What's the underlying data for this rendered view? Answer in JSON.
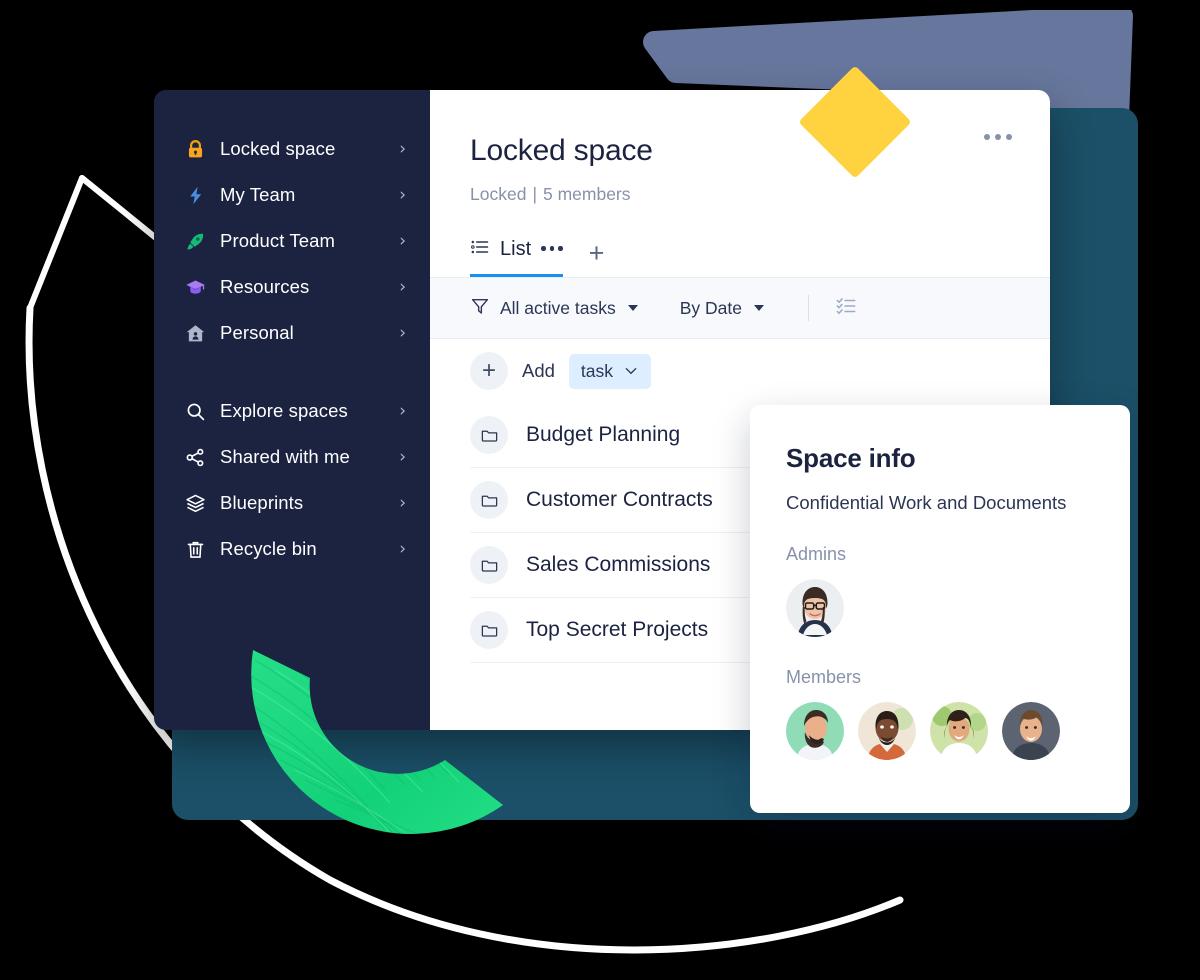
{
  "theme": {
    "sidebar_bg": "#1b2341",
    "teal_card": "#1b5068",
    "accent_blue": "#1b8ff0",
    "yellow_diamond": "#ffd23f",
    "blue_polygon": "#66769c",
    "green_arc": "#20d87f",
    "white_arc": "#ffffff",
    "pill_bg": "#dceeff"
  },
  "sidebar": {
    "spaces": [
      {
        "label": "Locked space",
        "icon": "lock-icon",
        "chevron": "›"
      },
      {
        "label": "My Team",
        "icon": "lightning-icon",
        "chevron": "›"
      },
      {
        "label": "Product Team",
        "icon": "rocket-icon",
        "chevron": "›"
      },
      {
        "label": "Resources",
        "icon": "graduation-icon",
        "chevron": "›"
      },
      {
        "label": "Personal",
        "icon": "home-icon",
        "chevron": "›"
      }
    ],
    "tools": [
      {
        "label": "Explore spaces",
        "icon": "search-icon",
        "chevron": "›"
      },
      {
        "label": "Shared with me",
        "icon": "share-icon",
        "chevron": "›"
      },
      {
        "label": "Blueprints",
        "icon": "layers-icon",
        "chevron": "›"
      },
      {
        "label": "Recycle bin",
        "icon": "trash-icon",
        "chevron": "›"
      }
    ]
  },
  "main": {
    "title": "Locked space",
    "status": "Locked",
    "separator": "|",
    "members_count": "5 members",
    "kebab": "more-options",
    "tabs": [
      {
        "label": "List",
        "icon": "list-view-icon",
        "active": true
      }
    ],
    "add_tab_label": "+",
    "filters": {
      "filter_icon": "funnel-icon",
      "status_filter": "All active tasks",
      "sort_filter": "By Date",
      "checklist_icon": "checklist-icon"
    },
    "add_row": {
      "plus": "+",
      "label": "Add",
      "type": "task"
    },
    "tasks": [
      {
        "name": "Budget Planning",
        "icon": "folder-icon"
      },
      {
        "name": "Customer Contracts",
        "icon": "folder-icon"
      },
      {
        "name": "Sales Commissions",
        "icon": "folder-icon"
      },
      {
        "name": "Top Secret Projects",
        "icon": "folder-icon"
      }
    ]
  },
  "space_info": {
    "title": "Space info",
    "description": "Confidential Work and Documents",
    "admins_label": "Admins",
    "members_label": "Members",
    "admins": [
      {
        "name": "admin-avatar-1",
        "bg": "#eceff1",
        "skin": "#f0c3a6",
        "hair": "#3a2b24",
        "shirt": "#26324a",
        "glasses": true
      }
    ],
    "members": [
      {
        "name": "member-avatar-1",
        "bg": "#8fdcb6",
        "skin": "#e9b089",
        "hair": "#3b2d26",
        "shirt": "#f2f4f7",
        "beard": true
      },
      {
        "name": "member-avatar-2",
        "bg": "#efe6d8",
        "skin": "#7a4b30",
        "hair": "#2a1c16",
        "shirt": "#d4693b",
        "beard": true
      },
      {
        "name": "member-avatar-3",
        "bg": "#cfe3a8",
        "skin": "#e2a97e",
        "hair": "#2f2119",
        "shirt": "#ffffff",
        "beard": false
      },
      {
        "name": "member-avatar-4",
        "bg": "#5c6472",
        "skin": "#e8b28c",
        "hair": "#6b4a2e",
        "shirt": "#3c4350",
        "beard": false
      }
    ]
  }
}
